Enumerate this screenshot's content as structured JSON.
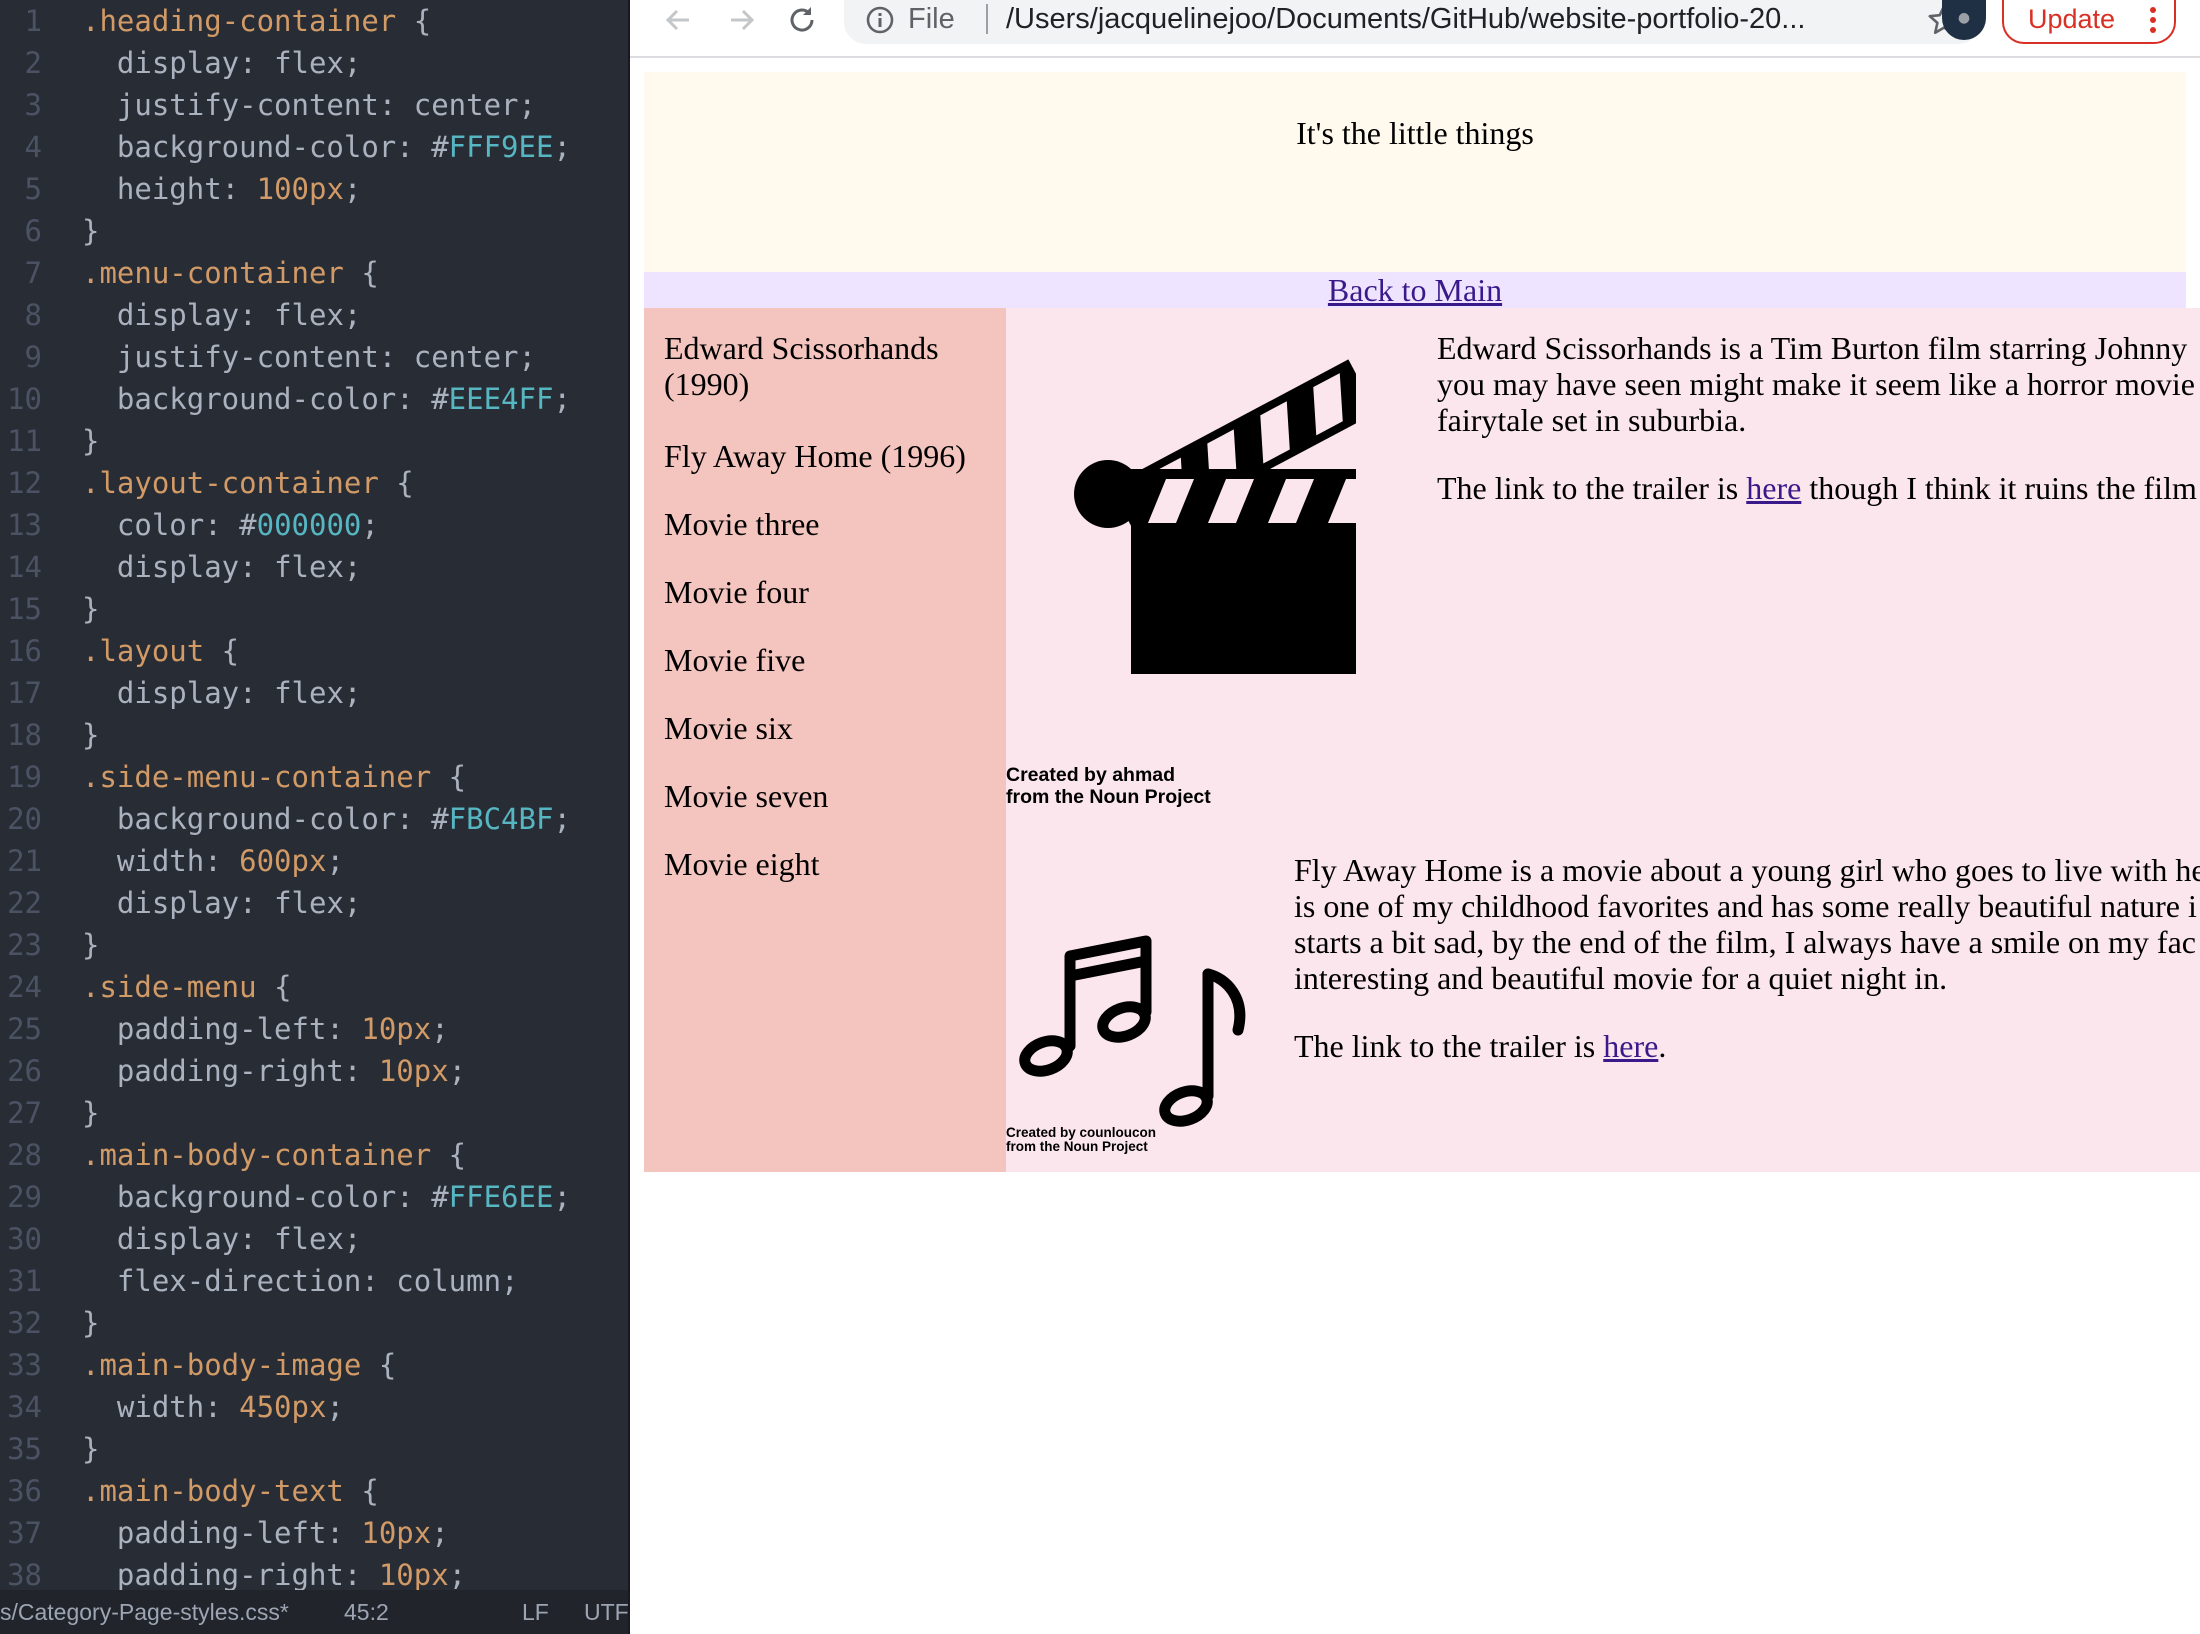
{
  "editor": {
    "lines": [
      {
        "n": "1",
        "parts": [
          [
            ".heading-container",
            "sel"
          ],
          [
            " {",
            "txt"
          ]
        ]
      },
      {
        "n": "2",
        "parts": [
          [
            "  display: ",
            "prop"
          ],
          [
            "flex",
            "txt"
          ],
          [
            ";",
            "txt"
          ]
        ]
      },
      {
        "n": "3",
        "parts": [
          [
            "  justify-content: ",
            "prop"
          ],
          [
            "center",
            "txt"
          ],
          [
            ";",
            "txt"
          ]
        ]
      },
      {
        "n": "4",
        "parts": [
          [
            "  background-color: ",
            "prop"
          ],
          [
            "#",
            "txt"
          ],
          [
            "FFF9EE",
            "hex"
          ],
          [
            ";",
            "txt"
          ]
        ]
      },
      {
        "n": "5",
        "parts": [
          [
            "  height: ",
            "prop"
          ],
          [
            "100px",
            "num"
          ],
          [
            ";",
            "txt"
          ]
        ]
      },
      {
        "n": "6",
        "parts": [
          [
            "}",
            "txt"
          ]
        ]
      },
      {
        "n": "7",
        "parts": [
          [
            ".menu-container",
            "sel"
          ],
          [
            " {",
            "txt"
          ]
        ]
      },
      {
        "n": "8",
        "parts": [
          [
            "  display: ",
            "prop"
          ],
          [
            "flex",
            "txt"
          ],
          [
            ";",
            "txt"
          ]
        ]
      },
      {
        "n": "9",
        "parts": [
          [
            "  justify-content: ",
            "prop"
          ],
          [
            "center",
            "txt"
          ],
          [
            ";",
            "txt"
          ]
        ]
      },
      {
        "n": "10",
        "parts": [
          [
            "  background-color: ",
            "prop"
          ],
          [
            "#",
            "txt"
          ],
          [
            "EEE4FF",
            "hex"
          ],
          [
            ";",
            "txt"
          ]
        ]
      },
      {
        "n": "11",
        "parts": [
          [
            "}",
            "txt"
          ]
        ]
      },
      {
        "n": "12",
        "parts": [
          [
            ".layout-container",
            "sel"
          ],
          [
            " {",
            "txt"
          ]
        ]
      },
      {
        "n": "13",
        "parts": [
          [
            "  color: ",
            "prop"
          ],
          [
            "#",
            "txt"
          ],
          [
            "000000",
            "hex"
          ],
          [
            ";",
            "txt"
          ]
        ]
      },
      {
        "n": "14",
        "parts": [
          [
            "  display: ",
            "prop"
          ],
          [
            "flex",
            "txt"
          ],
          [
            ";",
            "txt"
          ]
        ]
      },
      {
        "n": "15",
        "parts": [
          [
            "}",
            "txt"
          ]
        ]
      },
      {
        "n": "16",
        "parts": [
          [
            ".layout",
            "sel"
          ],
          [
            " {",
            "txt"
          ]
        ]
      },
      {
        "n": "17",
        "parts": [
          [
            "  display: ",
            "prop"
          ],
          [
            "flex",
            "txt"
          ],
          [
            ";",
            "txt"
          ]
        ]
      },
      {
        "n": "18",
        "parts": [
          [
            "}",
            "txt"
          ]
        ]
      },
      {
        "n": "19",
        "parts": [
          [
            ".side-menu-container",
            "sel"
          ],
          [
            " {",
            "txt"
          ]
        ]
      },
      {
        "n": "20",
        "parts": [
          [
            "  background-color: ",
            "prop"
          ],
          [
            "#",
            "txt"
          ],
          [
            "FBC4BF",
            "hex"
          ],
          [
            ";",
            "txt"
          ]
        ]
      },
      {
        "n": "21",
        "parts": [
          [
            "  width: ",
            "prop"
          ],
          [
            "600px",
            "num"
          ],
          [
            ";",
            "txt"
          ]
        ]
      },
      {
        "n": "22",
        "parts": [
          [
            "  display: ",
            "prop"
          ],
          [
            "flex",
            "txt"
          ],
          [
            ";",
            "txt"
          ]
        ]
      },
      {
        "n": "23",
        "parts": [
          [
            "}",
            "txt"
          ]
        ]
      },
      {
        "n": "24",
        "parts": [
          [
            ".side-menu",
            "sel"
          ],
          [
            " {",
            "txt"
          ]
        ]
      },
      {
        "n": "25",
        "parts": [
          [
            "  padding-left: ",
            "prop"
          ],
          [
            "10px",
            "num"
          ],
          [
            ";",
            "txt"
          ]
        ]
      },
      {
        "n": "26",
        "parts": [
          [
            "  padding-right: ",
            "prop"
          ],
          [
            "10px",
            "num"
          ],
          [
            ";",
            "txt"
          ]
        ]
      },
      {
        "n": "27",
        "parts": [
          [
            "}",
            "txt"
          ]
        ]
      },
      {
        "n": "28",
        "parts": [
          [
            ".main-body-container",
            "sel"
          ],
          [
            " {",
            "txt"
          ]
        ]
      },
      {
        "n": "29",
        "parts": [
          [
            "  background-color: ",
            "prop"
          ],
          [
            "#",
            "txt"
          ],
          [
            "FFE6EE",
            "hex"
          ],
          [
            ";",
            "txt"
          ]
        ]
      },
      {
        "n": "30",
        "parts": [
          [
            "  display: ",
            "prop"
          ],
          [
            "flex",
            "txt"
          ],
          [
            ";",
            "txt"
          ]
        ]
      },
      {
        "n": "31",
        "parts": [
          [
            "  flex-direction: ",
            "prop"
          ],
          [
            "column",
            "txt"
          ],
          [
            ";",
            "txt"
          ]
        ]
      },
      {
        "n": "32",
        "parts": [
          [
            "}",
            "txt"
          ]
        ]
      },
      {
        "n": "33",
        "parts": [
          [
            ".main-body-image",
            "sel"
          ],
          [
            " {",
            "txt"
          ]
        ]
      },
      {
        "n": "34",
        "parts": [
          [
            "  width: ",
            "prop"
          ],
          [
            "450px",
            "num"
          ],
          [
            ";",
            "txt"
          ]
        ]
      },
      {
        "n": "35",
        "parts": [
          [
            "}",
            "txt"
          ]
        ]
      },
      {
        "n": "36",
        "parts": [
          [
            ".main-body-text",
            "sel"
          ],
          [
            " {",
            "txt"
          ]
        ]
      },
      {
        "n": "37",
        "parts": [
          [
            "  padding-left: ",
            "prop"
          ],
          [
            "10px",
            "num"
          ],
          [
            ";",
            "txt"
          ]
        ]
      },
      {
        "n": "38",
        "parts": [
          [
            "  padding-right: ",
            "prop"
          ],
          [
            "10px",
            "num"
          ],
          [
            ";",
            "txt"
          ]
        ]
      }
    ]
  },
  "statusbar": {
    "file_path": "s/Category-Page-styles.css*",
    "cursor": "45:2",
    "line_ending": "LF",
    "encoding": "UTF"
  },
  "browser": {
    "scheme_label": "File",
    "url": "/Users/jacquelinejoo/Documents/GitHub/website-portfolio-20...",
    "update_label": "Update",
    "icons": [
      "back-arrow-icon",
      "forward-arrow-icon",
      "reload-icon",
      "info-icon",
      "star-icon",
      "avatar",
      "more-vert-icon"
    ],
    "accent_color": "#d93025"
  },
  "page": {
    "heading": "It's the little things",
    "menu_link": "Back to Main",
    "side_menu": [
      "Edward Scissorhands (1990)",
      "Fly Away Home (1996)",
      "Movie three",
      "Movie four",
      "Movie five",
      "Movie six",
      "Movie seven",
      "Movie eight"
    ],
    "entries": [
      {
        "icon": "clapperboard-icon",
        "credit_line1": "Created by ahmad",
        "credit_line2": "from the Noun Project",
        "lines": [
          "Edward Scissorhands is a Tim Burton film starring Johnny",
          "you may have seen might make it seem like a horror movie",
          "fairytale set in suburbia."
        ],
        "link_prefix": "The link to the trailer is ",
        "link_text": "here",
        "link_suffix": " though I think it ruins the film"
      },
      {
        "icon": "music-notes-icon",
        "credit_line1": "Created by counloucon",
        "credit_line2": "from the Noun Project",
        "lines": [
          "Fly Away Home is a movie about a young girl who goes to live with he",
          "is one of my childhood favorites and has some really beautiful nature i",
          "starts a bit sad, by the end of the film, I always have a smile on my fac",
          "interesting and beautiful movie for a quiet night in."
        ],
        "link_prefix": "The link to the trailer is ",
        "link_text": "here",
        "link_suffix": "."
      }
    ],
    "colors": {
      "heading_bg": "#FFF9EE",
      "menu_bg": "#EEE4FF",
      "side_menu_bg": "#FBC4BF",
      "main_body_bg": "#FFE6EE"
    }
  }
}
